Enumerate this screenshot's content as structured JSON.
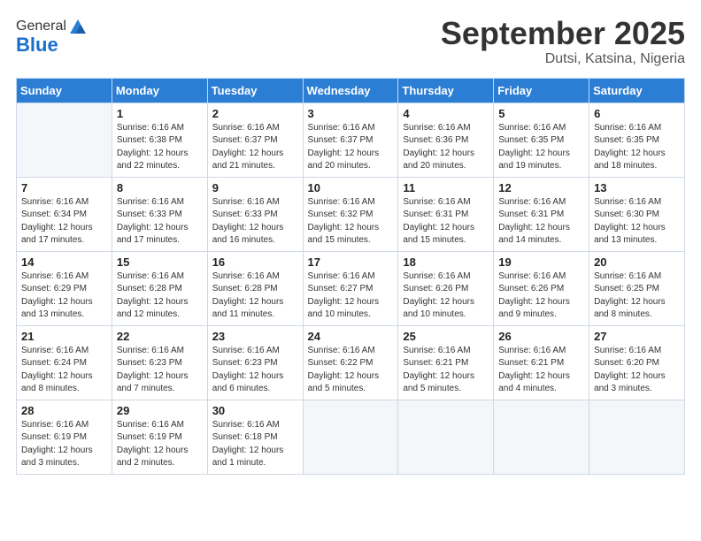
{
  "header": {
    "logo_general": "General",
    "logo_blue": "Blue",
    "month": "September 2025",
    "location": "Dutsi, Katsina, Nigeria"
  },
  "days_of_week": [
    "Sunday",
    "Monday",
    "Tuesday",
    "Wednesday",
    "Thursday",
    "Friday",
    "Saturday"
  ],
  "weeks": [
    [
      {
        "day": "",
        "info": ""
      },
      {
        "day": "1",
        "info": "Sunrise: 6:16 AM\nSunset: 6:38 PM\nDaylight: 12 hours\nand 22 minutes."
      },
      {
        "day": "2",
        "info": "Sunrise: 6:16 AM\nSunset: 6:37 PM\nDaylight: 12 hours\nand 21 minutes."
      },
      {
        "day": "3",
        "info": "Sunrise: 6:16 AM\nSunset: 6:37 PM\nDaylight: 12 hours\nand 20 minutes."
      },
      {
        "day": "4",
        "info": "Sunrise: 6:16 AM\nSunset: 6:36 PM\nDaylight: 12 hours\nand 20 minutes."
      },
      {
        "day": "5",
        "info": "Sunrise: 6:16 AM\nSunset: 6:35 PM\nDaylight: 12 hours\nand 19 minutes."
      },
      {
        "day": "6",
        "info": "Sunrise: 6:16 AM\nSunset: 6:35 PM\nDaylight: 12 hours\nand 18 minutes."
      }
    ],
    [
      {
        "day": "7",
        "info": "Sunrise: 6:16 AM\nSunset: 6:34 PM\nDaylight: 12 hours\nand 17 minutes."
      },
      {
        "day": "8",
        "info": "Sunrise: 6:16 AM\nSunset: 6:33 PM\nDaylight: 12 hours\nand 17 minutes."
      },
      {
        "day": "9",
        "info": "Sunrise: 6:16 AM\nSunset: 6:33 PM\nDaylight: 12 hours\nand 16 minutes."
      },
      {
        "day": "10",
        "info": "Sunrise: 6:16 AM\nSunset: 6:32 PM\nDaylight: 12 hours\nand 15 minutes."
      },
      {
        "day": "11",
        "info": "Sunrise: 6:16 AM\nSunset: 6:31 PM\nDaylight: 12 hours\nand 15 minutes."
      },
      {
        "day": "12",
        "info": "Sunrise: 6:16 AM\nSunset: 6:31 PM\nDaylight: 12 hours\nand 14 minutes."
      },
      {
        "day": "13",
        "info": "Sunrise: 6:16 AM\nSunset: 6:30 PM\nDaylight: 12 hours\nand 13 minutes."
      }
    ],
    [
      {
        "day": "14",
        "info": "Sunrise: 6:16 AM\nSunset: 6:29 PM\nDaylight: 12 hours\nand 13 minutes."
      },
      {
        "day": "15",
        "info": "Sunrise: 6:16 AM\nSunset: 6:28 PM\nDaylight: 12 hours\nand 12 minutes."
      },
      {
        "day": "16",
        "info": "Sunrise: 6:16 AM\nSunset: 6:28 PM\nDaylight: 12 hours\nand 11 minutes."
      },
      {
        "day": "17",
        "info": "Sunrise: 6:16 AM\nSunset: 6:27 PM\nDaylight: 12 hours\nand 10 minutes."
      },
      {
        "day": "18",
        "info": "Sunrise: 6:16 AM\nSunset: 6:26 PM\nDaylight: 12 hours\nand 10 minutes."
      },
      {
        "day": "19",
        "info": "Sunrise: 6:16 AM\nSunset: 6:26 PM\nDaylight: 12 hours\nand 9 minutes."
      },
      {
        "day": "20",
        "info": "Sunrise: 6:16 AM\nSunset: 6:25 PM\nDaylight: 12 hours\nand 8 minutes."
      }
    ],
    [
      {
        "day": "21",
        "info": "Sunrise: 6:16 AM\nSunset: 6:24 PM\nDaylight: 12 hours\nand 8 minutes."
      },
      {
        "day": "22",
        "info": "Sunrise: 6:16 AM\nSunset: 6:23 PM\nDaylight: 12 hours\nand 7 minutes."
      },
      {
        "day": "23",
        "info": "Sunrise: 6:16 AM\nSunset: 6:23 PM\nDaylight: 12 hours\nand 6 minutes."
      },
      {
        "day": "24",
        "info": "Sunrise: 6:16 AM\nSunset: 6:22 PM\nDaylight: 12 hours\nand 5 minutes."
      },
      {
        "day": "25",
        "info": "Sunrise: 6:16 AM\nSunset: 6:21 PM\nDaylight: 12 hours\nand 5 minutes."
      },
      {
        "day": "26",
        "info": "Sunrise: 6:16 AM\nSunset: 6:21 PM\nDaylight: 12 hours\nand 4 minutes."
      },
      {
        "day": "27",
        "info": "Sunrise: 6:16 AM\nSunset: 6:20 PM\nDaylight: 12 hours\nand 3 minutes."
      }
    ],
    [
      {
        "day": "28",
        "info": "Sunrise: 6:16 AM\nSunset: 6:19 PM\nDaylight: 12 hours\nand 3 minutes."
      },
      {
        "day": "29",
        "info": "Sunrise: 6:16 AM\nSunset: 6:19 PM\nDaylight: 12 hours\nand 2 minutes."
      },
      {
        "day": "30",
        "info": "Sunrise: 6:16 AM\nSunset: 6:18 PM\nDaylight: 12 hours\nand 1 minute."
      },
      {
        "day": "",
        "info": ""
      },
      {
        "day": "",
        "info": ""
      },
      {
        "day": "",
        "info": ""
      },
      {
        "day": "",
        "info": ""
      }
    ]
  ]
}
